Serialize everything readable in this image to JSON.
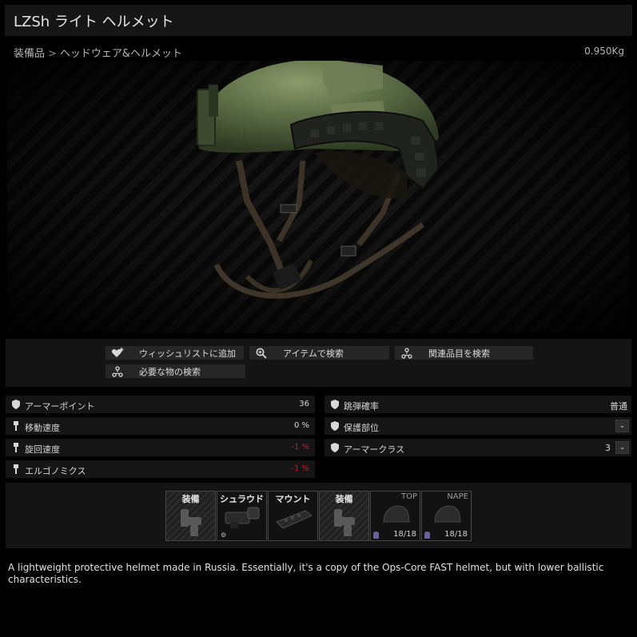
{
  "window": {
    "title": "LZSh ライト ヘルメット"
  },
  "breadcrumb": {
    "category": "装備品",
    "separator": ">",
    "subcategory": "ヘッドウェア&ヘルメット"
  },
  "weight": "0.950Kg",
  "actions": [
    {
      "label": "ウィッシュリストに追加",
      "icon": "heart-plus-icon"
    },
    {
      "label": "アイテムで検索",
      "icon": "search-icon"
    },
    {
      "label": "関連品目を検索",
      "icon": "nodes-icon"
    },
    {
      "label": "必要な物の検索",
      "icon": "nodes-icon"
    }
  ],
  "stats_left": [
    {
      "label": "アーマーポイント",
      "value": "36",
      "icon": "shield-icon"
    },
    {
      "label": "移動速度",
      "value": "0 %",
      "icon": "boot-icon"
    },
    {
      "label": "旋回速度",
      "value": "-1 %",
      "icon": "boot-icon"
    },
    {
      "label": "エルゴノミクス",
      "value": "-1 %",
      "icon": "boot-icon"
    }
  ],
  "stats_right": [
    {
      "label": "跳弾確率",
      "value": "普通",
      "icon": "shield-icon"
    },
    {
      "label": "保護部位",
      "value": "",
      "icon": "shield-icon",
      "dropdown": true
    },
    {
      "label": "アーマークラス",
      "value": "3",
      "icon": "shield-icon",
      "dropdown": true
    }
  ],
  "slots": [
    {
      "name": "装備",
      "type": "empty"
    },
    {
      "name": "シュラウド",
      "type": "filled"
    },
    {
      "name": "マウント",
      "type": "filled"
    },
    {
      "name": "装備",
      "type": "empty"
    },
    {
      "zone": "TOP",
      "durability": "18/18",
      "type": "armor"
    },
    {
      "zone": "NAPE",
      "durability": "18/18",
      "type": "armor"
    }
  ],
  "description": "A lightweight protective helmet made in Russia. Essentially, it's a copy of the Ops-Core FAST helmet, but with lower ballistic characteristics.",
  "colors": {
    "red_value": "#c02020",
    "helmet_green": "#5a6b43",
    "armor_mark": "#6a5fa0"
  }
}
